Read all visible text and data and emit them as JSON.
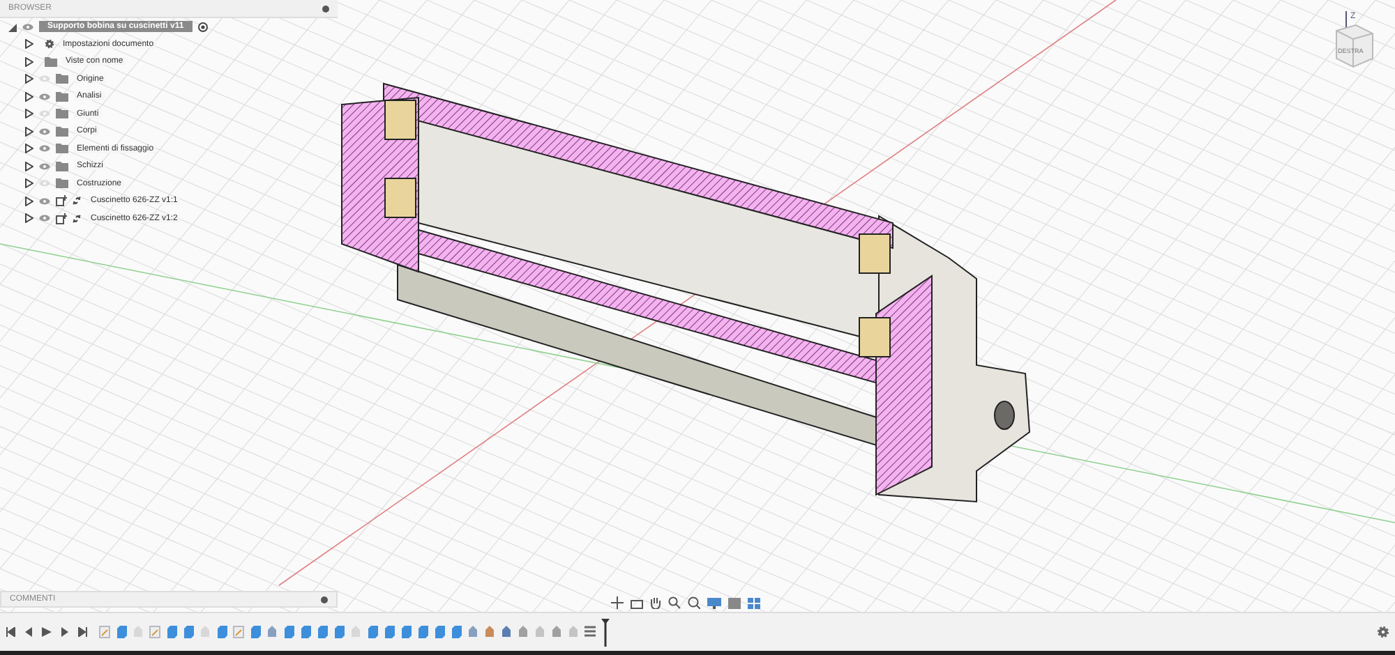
{
  "browser": {
    "title": "BROWSER",
    "root": {
      "label": "Supporto bobina su cuscinetti v11",
      "expanded": true,
      "visible": true
    },
    "items": [
      {
        "label": "Impostazioni documento",
        "kind": "settings",
        "expanded": false
      },
      {
        "label": "Viste con nome",
        "kind": "folder",
        "expanded": false
      },
      {
        "label": "Origine",
        "kind": "folder",
        "visible": false,
        "expanded": false
      },
      {
        "label": "Analisi",
        "kind": "folder",
        "visible": true,
        "expanded": false
      },
      {
        "label": "Giunti",
        "kind": "folder",
        "visible": false,
        "expanded": false
      },
      {
        "label": "Corpi",
        "kind": "folder",
        "visible": true,
        "expanded": false
      },
      {
        "label": "Elementi di fissaggio",
        "kind": "folder",
        "visible": true,
        "expanded": false
      },
      {
        "label": "Schizzi",
        "kind": "folder",
        "visible": true,
        "expanded": false
      },
      {
        "label": "Costruzione",
        "kind": "folder",
        "visible": false,
        "expanded": false
      },
      {
        "label": "Cuscinetto 626-ZZ v1:1",
        "kind": "component",
        "visible": true,
        "expanded": false
      },
      {
        "label": "Cuscinetto 626-ZZ v1:2",
        "kind": "component",
        "visible": true,
        "expanded": false
      }
    ]
  },
  "viewcube": {
    "axis": "Z",
    "face": "DESTRA"
  },
  "comments": {
    "title": "COMMENTI"
  },
  "timeline": [
    {
      "kind": "sketch"
    },
    {
      "kind": "body"
    },
    {
      "kind": "sweep"
    },
    {
      "kind": "sketch"
    },
    {
      "kind": "body"
    },
    {
      "kind": "body"
    },
    {
      "kind": "sweep"
    },
    {
      "kind": "body"
    },
    {
      "kind": "sketch"
    },
    {
      "kind": "body"
    },
    {
      "kind": "fillet"
    },
    {
      "kind": "body"
    },
    {
      "kind": "body"
    },
    {
      "kind": "body"
    },
    {
      "kind": "body"
    },
    {
      "kind": "sweep"
    },
    {
      "kind": "body"
    },
    {
      "kind": "body"
    },
    {
      "kind": "body"
    },
    {
      "kind": "body"
    },
    {
      "kind": "body"
    },
    {
      "kind": "body"
    },
    {
      "kind": "fillet"
    },
    {
      "kind": "split"
    },
    {
      "kind": "draft"
    },
    {
      "kind": "mesh"
    },
    {
      "kind": "plane"
    },
    {
      "kind": "mesh"
    },
    {
      "kind": "plane"
    },
    {
      "kind": "group"
    }
  ]
}
